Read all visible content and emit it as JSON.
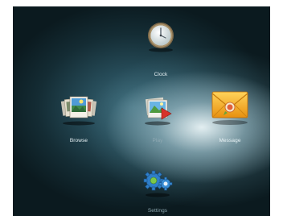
{
  "menu": {
    "items": [
      {
        "label": "Clock",
        "icon": "clock-icon"
      },
      {
        "label": "Browse",
        "icon": "photo-stack-icon"
      },
      {
        "label": "Play",
        "icon": "play-photo-icon"
      },
      {
        "label": "Message",
        "icon": "envelope-icon",
        "selected": true
      },
      {
        "label": "Settings",
        "icon": "gears-icon"
      }
    ]
  },
  "colors": {
    "background_dark": "#0b1a1f",
    "background_mid": "#3d6b7a",
    "highlight_glow": "#ebf5f7",
    "label_text": "#e8f2f5",
    "envelope_orange": "#f2a21f"
  }
}
